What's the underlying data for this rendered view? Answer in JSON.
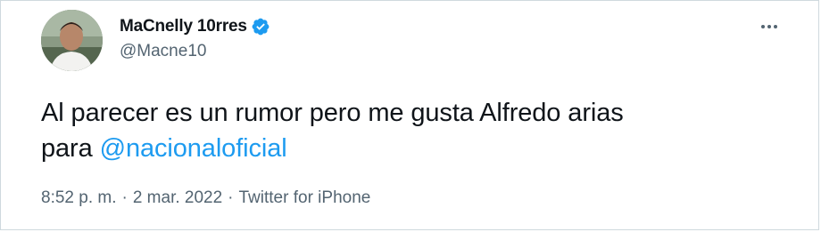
{
  "tweet": {
    "author": {
      "display_name": "MaCnelly 10rres",
      "handle": "@Macne10",
      "verified": true,
      "avatar_icon": "user-avatar"
    },
    "more_icon": "more-dots-icon",
    "text": {
      "line1": "Al parecer es un rumor pero me gusta Alfredo arias",
      "line2_prefix": "para ",
      "mention": "@nacionaloficial"
    },
    "meta": {
      "time": "8:52 p. m.",
      "separator": "·",
      "date": "2 mar. 2022",
      "source": "Twitter for iPhone"
    },
    "colors": {
      "link": "#1d9bf0",
      "secondary_text": "#536471",
      "verified_badge": "#1d9bf0"
    }
  }
}
